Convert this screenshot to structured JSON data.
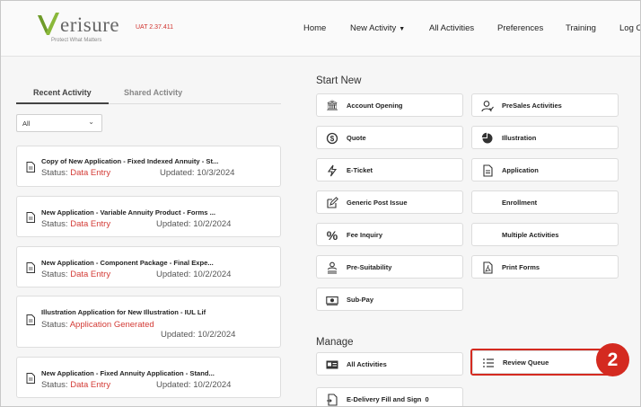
{
  "header": {
    "logo_word": "erisure",
    "logo_tagline": "Protect What Matters",
    "version": "UAT 2.37.411",
    "nav": [
      {
        "label": "Home"
      },
      {
        "label": "New Activity"
      },
      {
        "label": "All Activities"
      },
      {
        "label": "Preferences"
      },
      {
        "label": "Training"
      },
      {
        "label": "Log O"
      }
    ]
  },
  "left_panel": {
    "tabs": [
      {
        "label": "Recent Activity",
        "active": true
      },
      {
        "label": "Shared Activity",
        "active": false
      }
    ],
    "filter": {
      "selected": "All"
    },
    "status_prefix": "Status:",
    "cards": [
      {
        "title": "Copy of New Application - Fixed Indexed Annuity - St...",
        "status": "Data Entry",
        "updated": "Updated: 10/3/2024"
      },
      {
        "title": "New Application - Variable Annuity Product - Forms ...",
        "status": "Data Entry",
        "updated": "Updated: 10/2/2024"
      },
      {
        "title": "New Application - Component Package - Final Expe...",
        "status": "Data Entry",
        "updated": "Updated: 10/2/2024"
      },
      {
        "title": "Illustration Application for New Illustration - IUL Lif",
        "status": "Application Generated",
        "updated": "Updated: 10/2/2024"
      },
      {
        "title": "New Application - Fixed Annuity Application - Stand...",
        "status": "Data Entry",
        "updated": "Updated: 10/2/2024"
      }
    ]
  },
  "start_new": {
    "title": "Start New",
    "buttons": [
      {
        "label": "Account Opening",
        "icon": "bank-icon"
      },
      {
        "label": "PreSales Activities",
        "icon": "user-check-icon"
      },
      {
        "label": "Quote",
        "icon": "dollar-circle-icon"
      },
      {
        "label": "Illustration",
        "icon": "pie-chart-icon"
      },
      {
        "label": "E-Ticket",
        "icon": "lightning-icon"
      },
      {
        "label": "Application",
        "icon": "document-icon"
      },
      {
        "label": "Generic Post Issue",
        "icon": "edit-icon"
      },
      {
        "label": "Enrollment",
        "icon": ""
      },
      {
        "label": "Fee Inquiry",
        "icon": "percent-icon"
      },
      {
        "label": "Multiple Activities",
        "icon": ""
      },
      {
        "label": "Pre-Suitability",
        "icon": "person-scale-icon"
      },
      {
        "label": "Print Forms",
        "icon": "pdf-icon"
      },
      {
        "label": "Sub-Pay",
        "icon": "cash-icon"
      }
    ]
  },
  "manage": {
    "title": "Manage",
    "buttons": [
      {
        "label": "All Activities",
        "icon": "id-card-icon"
      },
      {
        "label": "Review Queue",
        "icon": "list-icon"
      },
      {
        "label": "E-Delivery Fill and Sign",
        "count": "0",
        "icon": "document-sign-icon"
      }
    ]
  },
  "callout": {
    "number": "2",
    "color": "#d42a20"
  },
  "colors": {
    "status_red": "#d33b36",
    "logo_green": "#8ab83a"
  }
}
